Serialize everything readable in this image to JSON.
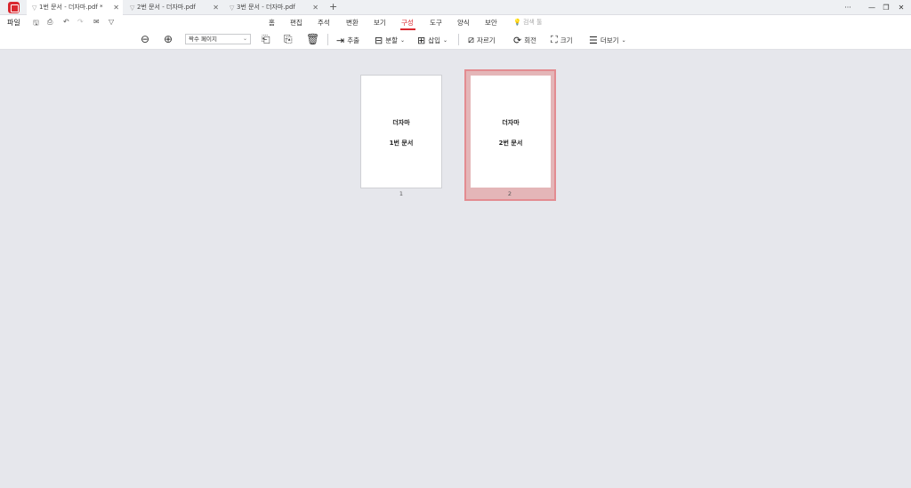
{
  "tabs": [
    {
      "label": "1번 문서 - 더자마.pdf *",
      "active": true
    },
    {
      "label": "2번 문서 - 더자마.pdf",
      "active": false
    },
    {
      "label": "3번 문서 - 더자마.pdf",
      "active": false
    }
  ],
  "new_tab_icon": "+",
  "window_controls": {
    "more": "···",
    "minimize": "—",
    "restore": "❐",
    "close": "✕"
  },
  "menu": {
    "file": "파일",
    "nav_tabs": [
      "홈",
      "편집",
      "주석",
      "변환",
      "보기",
      "구성",
      "도구",
      "양식",
      "보안"
    ],
    "selected_tab": "구성",
    "search_hint": "검색 툴"
  },
  "toolbar": {
    "zoom_select_value": "짝수 페이지",
    "extract": "추출",
    "split": "분할",
    "insert": "삽입",
    "crop": "자르기",
    "rotate": "회전",
    "size": "크기",
    "more": "더보기"
  },
  "pages": [
    {
      "line1": "더자마",
      "line2": "1번 문서",
      "number": "1",
      "selected": false
    },
    {
      "line1": "더자마",
      "line2": "2번 문서",
      "number": "2",
      "selected": true
    }
  ],
  "colors": {
    "accent": "#d9282f",
    "selection_fill": "#e4b6b8",
    "selection_border": "#e38c91",
    "background": "#e6e7ec"
  },
  "icons": [
    "app-logo-icon",
    "save-icon",
    "print-icon",
    "undo-icon",
    "redo-icon",
    "mail-icon",
    "dropdown-icon",
    "zoom-out-icon",
    "zoom-in-icon",
    "insert-left-icon",
    "insert-right-icon",
    "delete-icon",
    "extract-icon",
    "split-icon",
    "insert-icon",
    "crop-icon",
    "rotate-icon",
    "size-icon",
    "more-list-icon"
  ]
}
